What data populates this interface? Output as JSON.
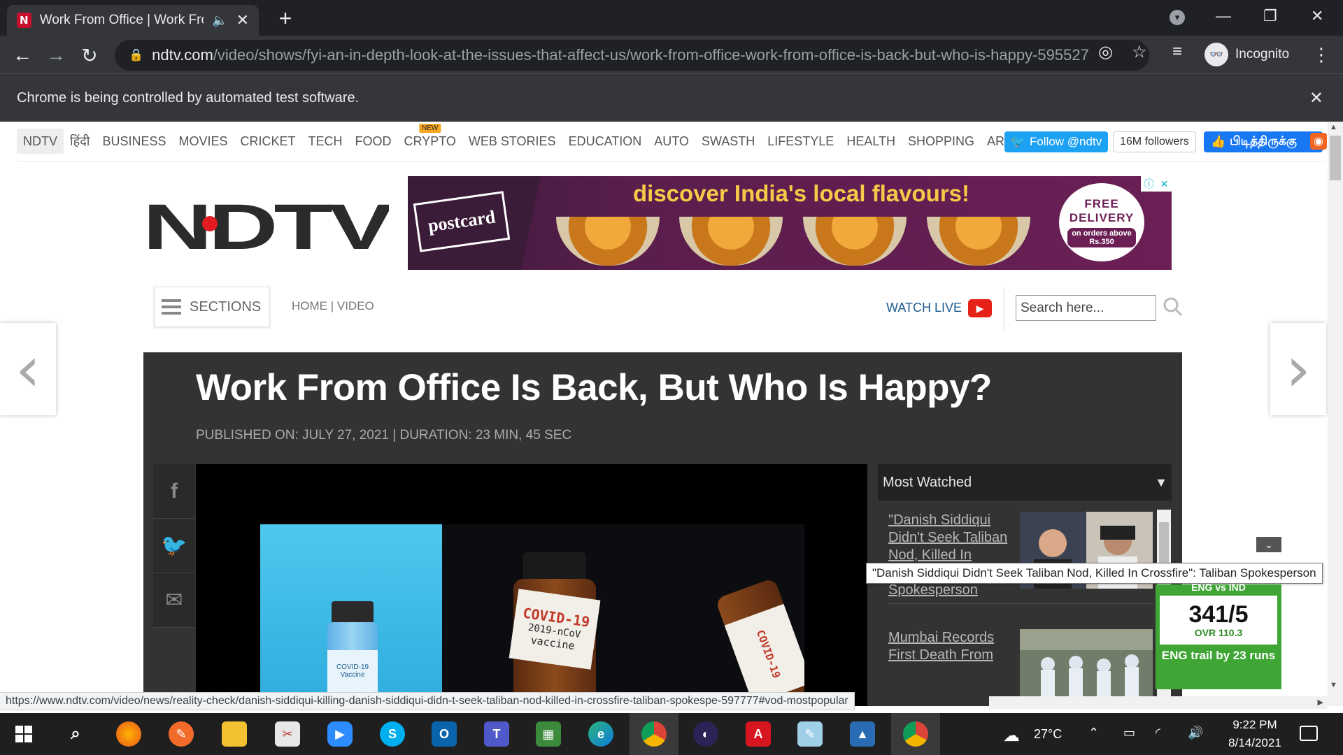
{
  "browser": {
    "tab": {
      "favicon": "N",
      "title": "Work From Office | Work From Office Is Back, But Who Is Happy?",
      "audio_icon": "speaker-icon"
    },
    "url": {
      "host": "ndtv.com",
      "path": "/video/shows/fyi-an-in-depth-look-at-the-issues-that-affect-us/work-from-office-work-from-office-is-back-but-who-is-happy-595527"
    },
    "profile_label": "Incognito",
    "infobar_text": "Chrome is being controlled by automated test software.",
    "status_url": "https://www.ndtv.com/video/news/reality-check/danish-siddiqui-killing-danish-siddiqui-didn-t-seek-taliban-nod-killed-in-crossfire-taliban-spokespe-597777#vod-mostpopular"
  },
  "site": {
    "nav": [
      {
        "label": "NDTV",
        "active": true
      },
      {
        "label": "हिंदी"
      },
      {
        "label": "BUSINESS"
      },
      {
        "label": "MOVIES"
      },
      {
        "label": "CRICKET"
      },
      {
        "label": "TECH"
      },
      {
        "label": "FOOD"
      },
      {
        "label": "CRYPTO",
        "badge": "NEW"
      },
      {
        "label": "WEB STORIES"
      },
      {
        "label": "EDUCATION"
      },
      {
        "label": "AUTO"
      },
      {
        "label": "SWASTH"
      },
      {
        "label": "LIFESTYLE"
      },
      {
        "label": "HEALTH"
      },
      {
        "label": "SHOPPING"
      },
      {
        "label": "ART"
      }
    ],
    "social": {
      "twitter_follow": "Follow @ndtv",
      "followers": "16M followers",
      "facebook_like": "பிடித்திருக்கு"
    },
    "logo_text": "NDTV",
    "ad": {
      "brand": "postcard",
      "headline": "discover India's local flavours!",
      "badge_line1": "FREE",
      "badge_line2": "DELIVERY",
      "badge_line3": "on orders above",
      "badge_line4": "Rs.350"
    },
    "sections_label": "SECTIONS",
    "breadcrumb": "HOME | VIDEO",
    "watch_live": "WATCH LIVE",
    "search_placeholder": "Search here..."
  },
  "article": {
    "headline": "Work From Office Is Back, But Who Is Happy?",
    "published": "PUBLISHED ON: JULY 27, 2021 | DURATION: 23 MIN, 45 SEC",
    "share_icons": [
      "facebook-icon",
      "twitter-icon",
      "email-icon"
    ],
    "video_labels": {
      "small_vial_1": "COVID-19",
      "small_vial_2": "Vaccine",
      "big_vial_1": "COVID-19",
      "big_vial_2": "2019-nCoV",
      "big_vial_3": "vaccine",
      "fallen_vial": "COVID-19"
    }
  },
  "most_watched": {
    "title": "Most Watched",
    "items": [
      {
        "title": "\"Danish Siddiqui Didn't Seek Taliban Nod, Killed In Crossfire\": Taliban Spokesperson"
      },
      {
        "title": "Mumbai Records First Death From"
      }
    ],
    "tooltip": "\"Danish Siddiqui Didn't Seek Taliban Nod, Killed In Crossfire\": Taliban Spokesperson"
  },
  "cricket_widget": {
    "header": "ENG vs IND",
    "score": "341/5",
    "overs": "OVR 110.3",
    "status": "ENG trail by 23 runs"
  },
  "taskbar": {
    "weather": "27°C",
    "time": "9:22 PM",
    "date": "8/14/2021"
  },
  "colors": {
    "ndtv_red": "#e31b23",
    "article_bg": "#333333",
    "cricket_green": "#3fa535",
    "twitter_blue": "#1da1f2",
    "facebook_blue": "#1877f2"
  }
}
